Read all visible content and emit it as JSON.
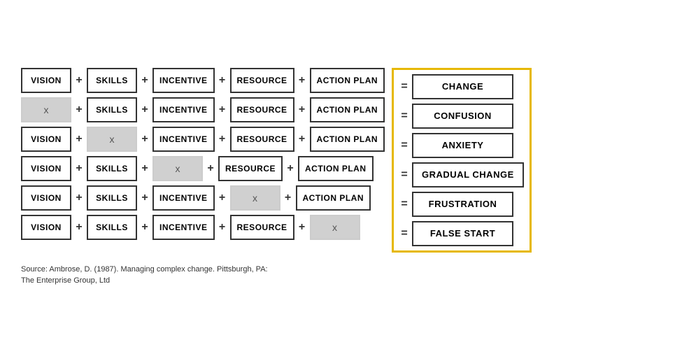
{
  "rows": [
    {
      "cells": [
        {
          "type": "normal",
          "text": "VISION"
        },
        {
          "type": "op",
          "text": "+"
        },
        {
          "type": "normal",
          "text": "SKILLS"
        },
        {
          "type": "op",
          "text": "+"
        },
        {
          "type": "normal",
          "text": "INCENTIVE"
        },
        {
          "type": "op",
          "text": "+"
        },
        {
          "type": "normal",
          "text": "RESOURCE"
        },
        {
          "type": "op",
          "text": "+"
        },
        {
          "type": "normal",
          "text": "ACTION PLAN"
        }
      ],
      "equals": "=",
      "result": "CHANGE"
    },
    {
      "cells": [
        {
          "type": "x",
          "text": "x"
        },
        {
          "type": "op",
          "text": "+"
        },
        {
          "type": "normal",
          "text": "SKILLS"
        },
        {
          "type": "op",
          "text": "+"
        },
        {
          "type": "normal",
          "text": "INCENTIVE"
        },
        {
          "type": "op",
          "text": "+"
        },
        {
          "type": "normal",
          "text": "RESOURCE"
        },
        {
          "type": "op",
          "text": "+"
        },
        {
          "type": "normal",
          "text": "ACTION PLAN"
        }
      ],
      "equals": "=",
      "result": "CONFUSION"
    },
    {
      "cells": [
        {
          "type": "normal",
          "text": "VISION"
        },
        {
          "type": "op",
          "text": "+"
        },
        {
          "type": "x",
          "text": "x"
        },
        {
          "type": "op",
          "text": "+"
        },
        {
          "type": "normal",
          "text": "INCENTIVE"
        },
        {
          "type": "op",
          "text": "+"
        },
        {
          "type": "normal",
          "text": "RESOURCE"
        },
        {
          "type": "op",
          "text": "+"
        },
        {
          "type": "normal",
          "text": "ACTION PLAN"
        }
      ],
      "equals": "=",
      "result": "ANXIETY"
    },
    {
      "cells": [
        {
          "type": "normal",
          "text": "VISION"
        },
        {
          "type": "op",
          "text": "+"
        },
        {
          "type": "normal",
          "text": "SKILLS"
        },
        {
          "type": "op",
          "text": "+"
        },
        {
          "type": "x",
          "text": "x"
        },
        {
          "type": "op",
          "text": "+"
        },
        {
          "type": "normal",
          "text": "RESOURCE"
        },
        {
          "type": "op",
          "text": "+"
        },
        {
          "type": "normal",
          "text": "ACTION PLAN"
        }
      ],
      "equals": "=",
      "result": "GRADUAL CHANGE"
    },
    {
      "cells": [
        {
          "type": "normal",
          "text": "VISION"
        },
        {
          "type": "op",
          "text": "+"
        },
        {
          "type": "normal",
          "text": "SKILLS"
        },
        {
          "type": "op",
          "text": "+"
        },
        {
          "type": "normal",
          "text": "INCENTIVE"
        },
        {
          "type": "op",
          "text": "+"
        },
        {
          "type": "x",
          "text": "x"
        },
        {
          "type": "op",
          "text": "+"
        },
        {
          "type": "normal",
          "text": "ACTION PLAN"
        }
      ],
      "equals": "=",
      "result": "FRUSTRATION"
    },
    {
      "cells": [
        {
          "type": "normal",
          "text": "VISION"
        },
        {
          "type": "op",
          "text": "+"
        },
        {
          "type": "normal",
          "text": "SKILLS"
        },
        {
          "type": "op",
          "text": "+"
        },
        {
          "type": "normal",
          "text": "INCENTIVE"
        },
        {
          "type": "op",
          "text": "+"
        },
        {
          "type": "normal",
          "text": "RESOURCE"
        },
        {
          "type": "op",
          "text": "+"
        },
        {
          "type": "x",
          "text": "x"
        }
      ],
      "equals": "=",
      "result": "FALSE START"
    }
  ],
  "source": {
    "line1": "Source: Ambrose, D. (1987). Managing complex change. Pittsburgh, PA:",
    "line2": "The Enterprise Group, Ltd"
  }
}
